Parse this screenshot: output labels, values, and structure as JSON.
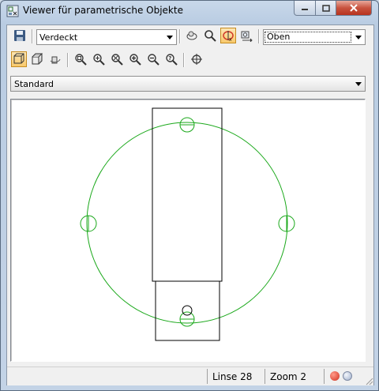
{
  "window": {
    "title": "Viewer für parametrische Objekte",
    "icons": {
      "app": "viewer-app-icon",
      "minimize": "minimize-icon",
      "maximize": "maximize-icon",
      "close": "close-icon"
    }
  },
  "toolbar1": {
    "save_icon": "save-icon",
    "visual_style": {
      "selected": "Verdeckt"
    },
    "buttons": [
      "orbit-icon",
      "zoom-icon",
      "free-orbit-icon",
      "camera-icon"
    ],
    "view": {
      "selected": "Oben"
    }
  },
  "toolbar2": {
    "buttons": [
      "2d-wireframe-icon",
      "3d-box-icon",
      "3d-orbit-icon",
      "zoom-window-icon",
      "zoom-in-icon",
      "zoom-extents-icon",
      "zoom-in-plus-icon",
      "zoom-out-icon",
      "zoom-help-icon",
      "center-target-icon"
    ]
  },
  "preset": {
    "selected": "Standard"
  },
  "status": {
    "lines": "Linse 28",
    "zoom": "Zoom 2"
  },
  "colors": {
    "drawing_green": "#1aa81a",
    "status_red": "#e55a4a",
    "status_blue": "#b8c4da"
  }
}
